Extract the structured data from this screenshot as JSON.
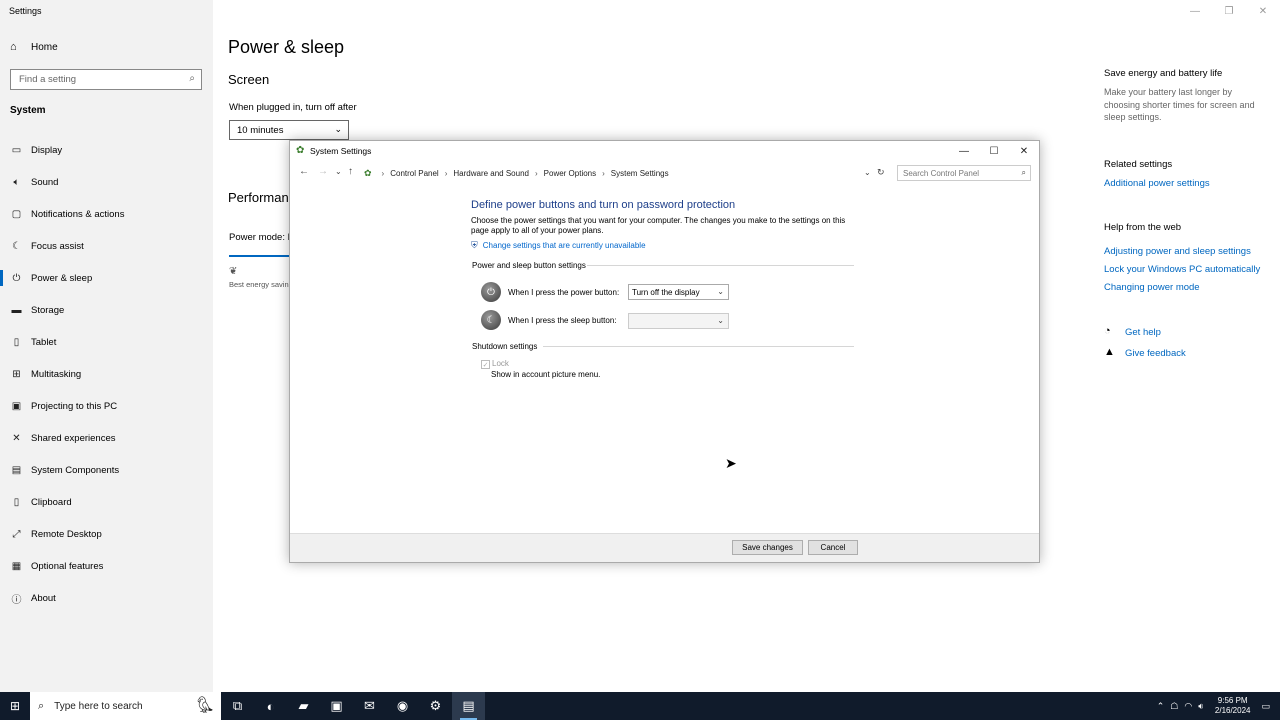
{
  "settings": {
    "window_title": "Settings",
    "home_label": "Home",
    "search_placeholder": "Find a setting",
    "section_label": "System",
    "nav_items": [
      {
        "label": "Display"
      },
      {
        "label": "Sound"
      },
      {
        "label": "Notifications & actions"
      },
      {
        "label": "Focus assist"
      },
      {
        "label": "Power & sleep"
      },
      {
        "label": "Storage"
      },
      {
        "label": "Tablet"
      },
      {
        "label": "Multitasking"
      },
      {
        "label": "Projecting to this PC"
      },
      {
        "label": "Shared experiences"
      },
      {
        "label": "System Components"
      },
      {
        "label": "Clipboard"
      },
      {
        "label": "Remote Desktop"
      },
      {
        "label": "Optional features"
      },
      {
        "label": "About"
      }
    ],
    "active_nav": "Power & sleep",
    "page_title": "Power & sleep",
    "screen_heading": "Screen",
    "plugged_label": "When plugged in, turn off after",
    "screen_value": "10 minutes",
    "perf_heading": "Performan",
    "power_mode_label": "Power mode: B",
    "best_label": "Best energy savin"
  },
  "right_pane": {
    "save_energy_heading": "Save energy and battery life",
    "save_energy_text": "Make your battery last longer by choosing shorter times for screen and sleep settings.",
    "related_heading": "Related settings",
    "related_link": "Additional power settings",
    "help_heading": "Help from the web",
    "help_links": [
      "Adjusting power and sleep settings",
      "Lock your Windows PC automatically",
      "Changing power mode"
    ],
    "get_help": "Get help",
    "give_feedback": "Give feedback"
  },
  "dialog": {
    "title": "System Settings",
    "breadcrumb": [
      "Control Panel",
      "Hardware and Sound",
      "Power Options",
      "System Settings"
    ],
    "search_placeholder": "Search Control Panel",
    "heading": "Define power buttons and turn on password protection",
    "description": "Choose the power settings that you want for your computer. The changes you make to the settings on this page apply to all of your power plans.",
    "change_link": "Change settings that are currently unavailable",
    "group1_label": "Power and sleep button settings",
    "power_button_label": "When I press the power button:",
    "power_button_value": "Turn off the display",
    "sleep_button_label": "When I press the sleep button:",
    "sleep_button_value": "",
    "group2_label": "Shutdown settings",
    "lock_label": "Lock",
    "lock_desc": "Show in account picture menu.",
    "save_button": "Save changes",
    "cancel_button": "Cancel"
  },
  "taskbar": {
    "search_placeholder": "Type here to search",
    "time": "9:56 PM",
    "date": "2/16/2024"
  },
  "colors": {
    "accent": "#0067c0",
    "cp_heading": "#1e3f8a",
    "taskbar_bg": "#101b2b"
  }
}
